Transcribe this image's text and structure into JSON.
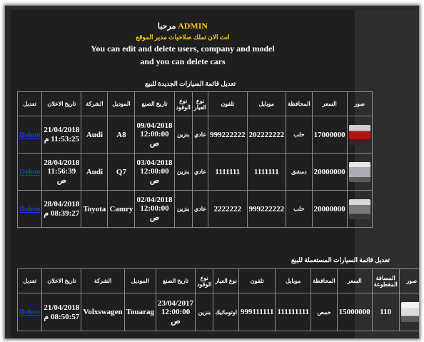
{
  "header": {
    "admin": "ADMIN",
    "welcome": "مرحبا",
    "permissions": "انت الان تملك صلاحيات مدير الموقع",
    "line1": "You can  edit and delete users, company and model",
    "line2": "and you can delete cars"
  },
  "new_cars": {
    "caption": "تعديل قائمة السيارات الجديدة للبيع",
    "columns": [
      "صور",
      "السعر",
      "المحافظة",
      "موبايل",
      "تلفون",
      "نوع العيار",
      "نوع الوقود",
      "تاريخ الصنع",
      "الموديل",
      "الشركة",
      "تاريخ الاعلان",
      "تعديل"
    ],
    "rows": [
      {
        "image": "red-car-icon",
        "price": "17000000",
        "province": "حلب",
        "mobile": "202222222",
        "phone": "999222222",
        "gear": "عادي",
        "fuel": "بنزين",
        "manufacture_date": "09/04/2018 12:00:00 ص",
        "model": "A8",
        "company": "Audi",
        "ad_date": "21/04/2018 11:53:25 م",
        "action": "Delete"
      },
      {
        "image": "silver-suv-icon",
        "price": "20000000",
        "province": "دمشق",
        "mobile": "1111111",
        "phone": "1111111",
        "gear": "عادي",
        "fuel": "بنزين",
        "manufacture_date": "03/04/2018 12:00:00 ص",
        "model": "Q7",
        "company": "Audi",
        "ad_date": "28/04/2018 11:56:39 ص",
        "action": "Delete"
      },
      {
        "image": "grey-car-icon",
        "price": "20000000",
        "province": "حلب",
        "mobile": "999222222",
        "phone": "2222222",
        "gear": "عادي",
        "fuel": "بنزين",
        "manufacture_date": "02/04/2018 12:00:00 ص",
        "model": "Camry",
        "company": "Toyota",
        "ad_date": "28/04/2018 08:39:27 م",
        "action": "Delete"
      }
    ]
  },
  "used_cars": {
    "caption": "تعديل قائمة السيارات المستعملة للبيع",
    "columns": [
      "صور",
      "المسافة المقطوعة",
      "السعر",
      "المحافظة",
      "موبايل",
      "تلفون",
      "نوع العيار",
      "نوع الوقود",
      "تاريخ الصنع",
      "الموديل",
      "الشركة",
      "تاريخ الاعلان",
      "تعديل"
    ],
    "rows": [
      {
        "image": "white-suv-icon",
        "distance": "110",
        "price": "15000000",
        "province": "حمص",
        "mobile": "111111111",
        "phone": "999111111",
        "gear": "اوتوماتيك",
        "fuel": "بنزين",
        "manufacture_date": "23/04/2017 12:00:00 ص",
        "model": "Touarag",
        "company": "Volxswagen",
        "ad_date": "21/04/2018 08:50:57 م",
        "action": "Delete"
      }
    ]
  },
  "colors": {
    "accent": "#f2c81e",
    "link": "#1a33ff",
    "background": "#1f1f1f"
  }
}
